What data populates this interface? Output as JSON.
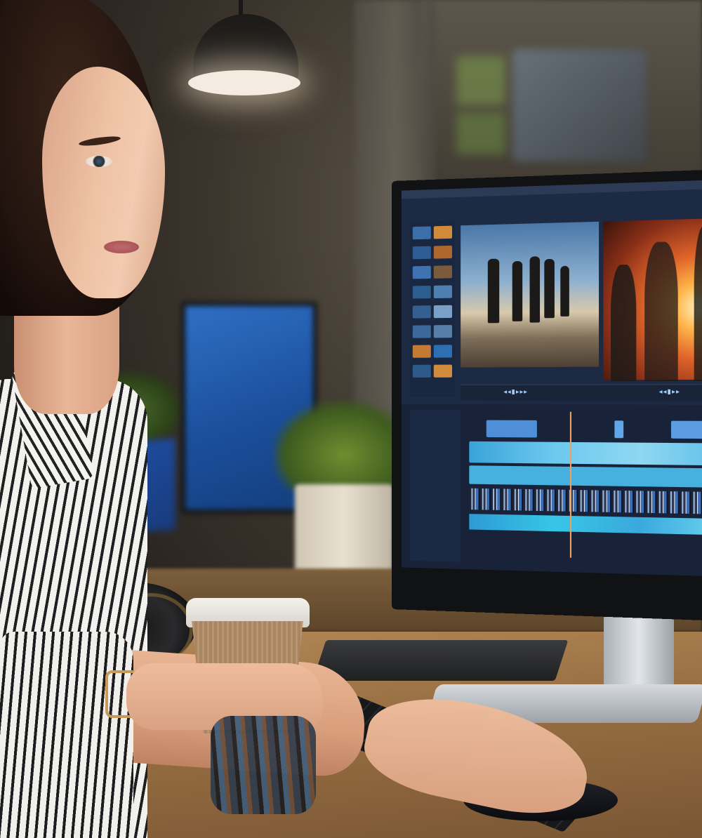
{
  "scene": {
    "palette": {
      "background": "#3b352d",
      "desk": "#9a7144",
      "screen": "#1d2a44",
      "accent_warm": "#ffb54a",
      "accent_cool": "#37c6e6"
    },
    "icons": [
      "lamp-icon",
      "headphones-icon",
      "coffee-cup-icon",
      "monitor-icon",
      "keyboard-icon",
      "mouse-icon"
    ]
  },
  "screen_ui": {
    "transport_left": "◂◂▮▸▸▸",
    "transport_right": "◂◂▮▸▸"
  }
}
